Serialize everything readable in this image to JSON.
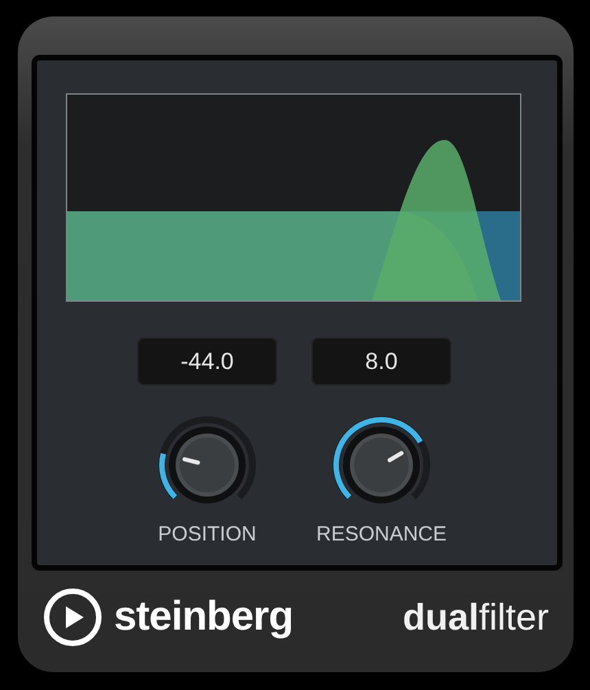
{
  "knobs": [
    {
      "value": "-44.0",
      "label": "POSITION"
    },
    {
      "value": "8.0",
      "label": "RESONANCE"
    }
  ],
  "footer": {
    "brand": "steinberg",
    "product_bold": "dual",
    "product_light": "filter"
  }
}
